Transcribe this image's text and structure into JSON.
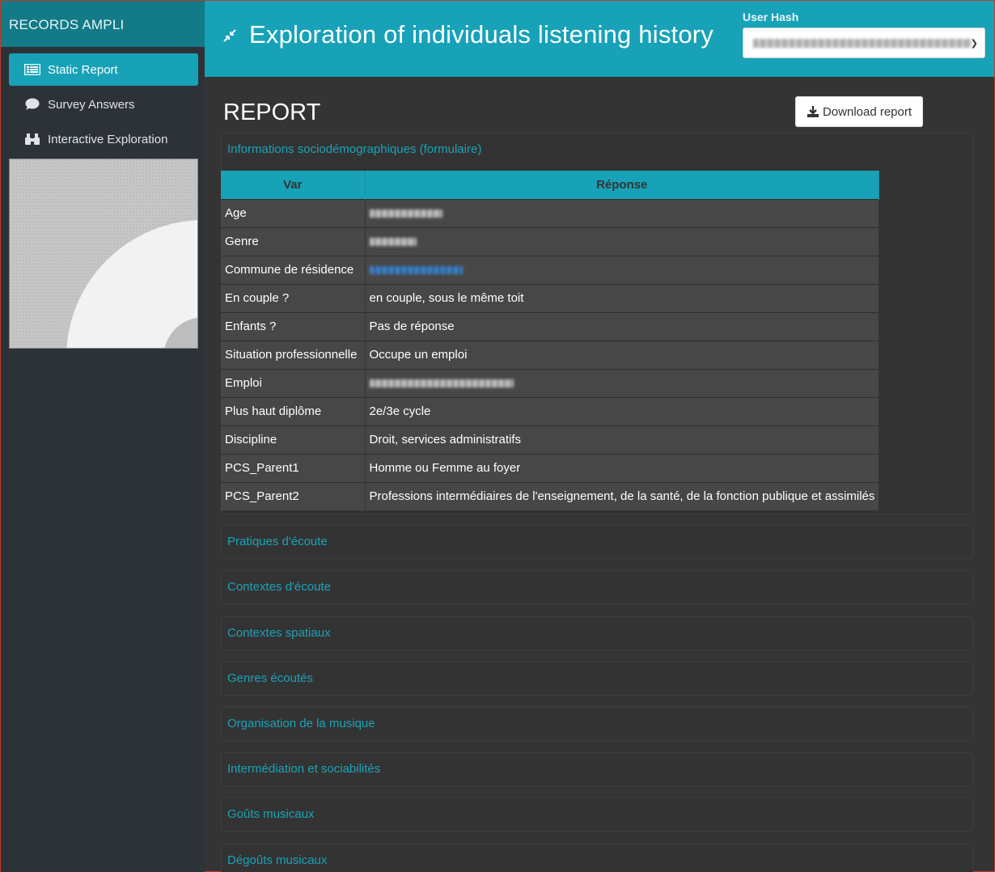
{
  "brand": "RECORDS AMPLI",
  "nav": [
    {
      "label": "Static Report",
      "icon": "report-icon",
      "active": true
    },
    {
      "label": "Survey Answers",
      "icon": "comment-icon",
      "active": false
    },
    {
      "label": "Interactive Exploration",
      "icon": "binoculars-icon",
      "active": false
    }
  ],
  "header": {
    "title": "Exploration of individuals listening history",
    "user_label": "User Hash"
  },
  "report": {
    "title": "REPORT",
    "download_label": "Download report"
  },
  "sections": [
    "Informations sociodémographiques (formulaire)",
    "Pratiques d'écoute",
    "Contextes d'écoute",
    "Contextes spatiaux",
    "Genres écoutés",
    "Organisation de la musique",
    "Intermédiation et sociabilités",
    "Goûts musicaux",
    "Dégoûts musicaux"
  ],
  "table": {
    "headers": [
      "Var",
      "Réponse"
    ],
    "rows": [
      {
        "var": "Age",
        "value": ""
      },
      {
        "var": "Genre",
        "value": ""
      },
      {
        "var": "Commune de résidence",
        "value": ""
      },
      {
        "var": "En couple ?",
        "value": "en couple, sous le même toit"
      },
      {
        "var": "Enfants ?",
        "value": "Pas de réponse"
      },
      {
        "var": "Situation professionnelle",
        "value": "Occupe un emploi"
      },
      {
        "var": "Emploi",
        "value": ""
      },
      {
        "var": "Plus haut diplôme",
        "value": "2e/3e cycle"
      },
      {
        "var": "Discipline",
        "value": "Droit, services administratifs"
      },
      {
        "var": "PCS_Parent1",
        "value": "Homme ou Femme au foyer"
      },
      {
        "var": "PCS_Parent2",
        "value": "Professions intermédiaires de l'enseignement, de la santé, de la fonction publique et assimilés"
      }
    ]
  },
  "colors": {
    "accent": "#17a2b8",
    "sidebar": "#2c3238",
    "brand_bg": "#137a87",
    "content_bg": "#343434"
  }
}
